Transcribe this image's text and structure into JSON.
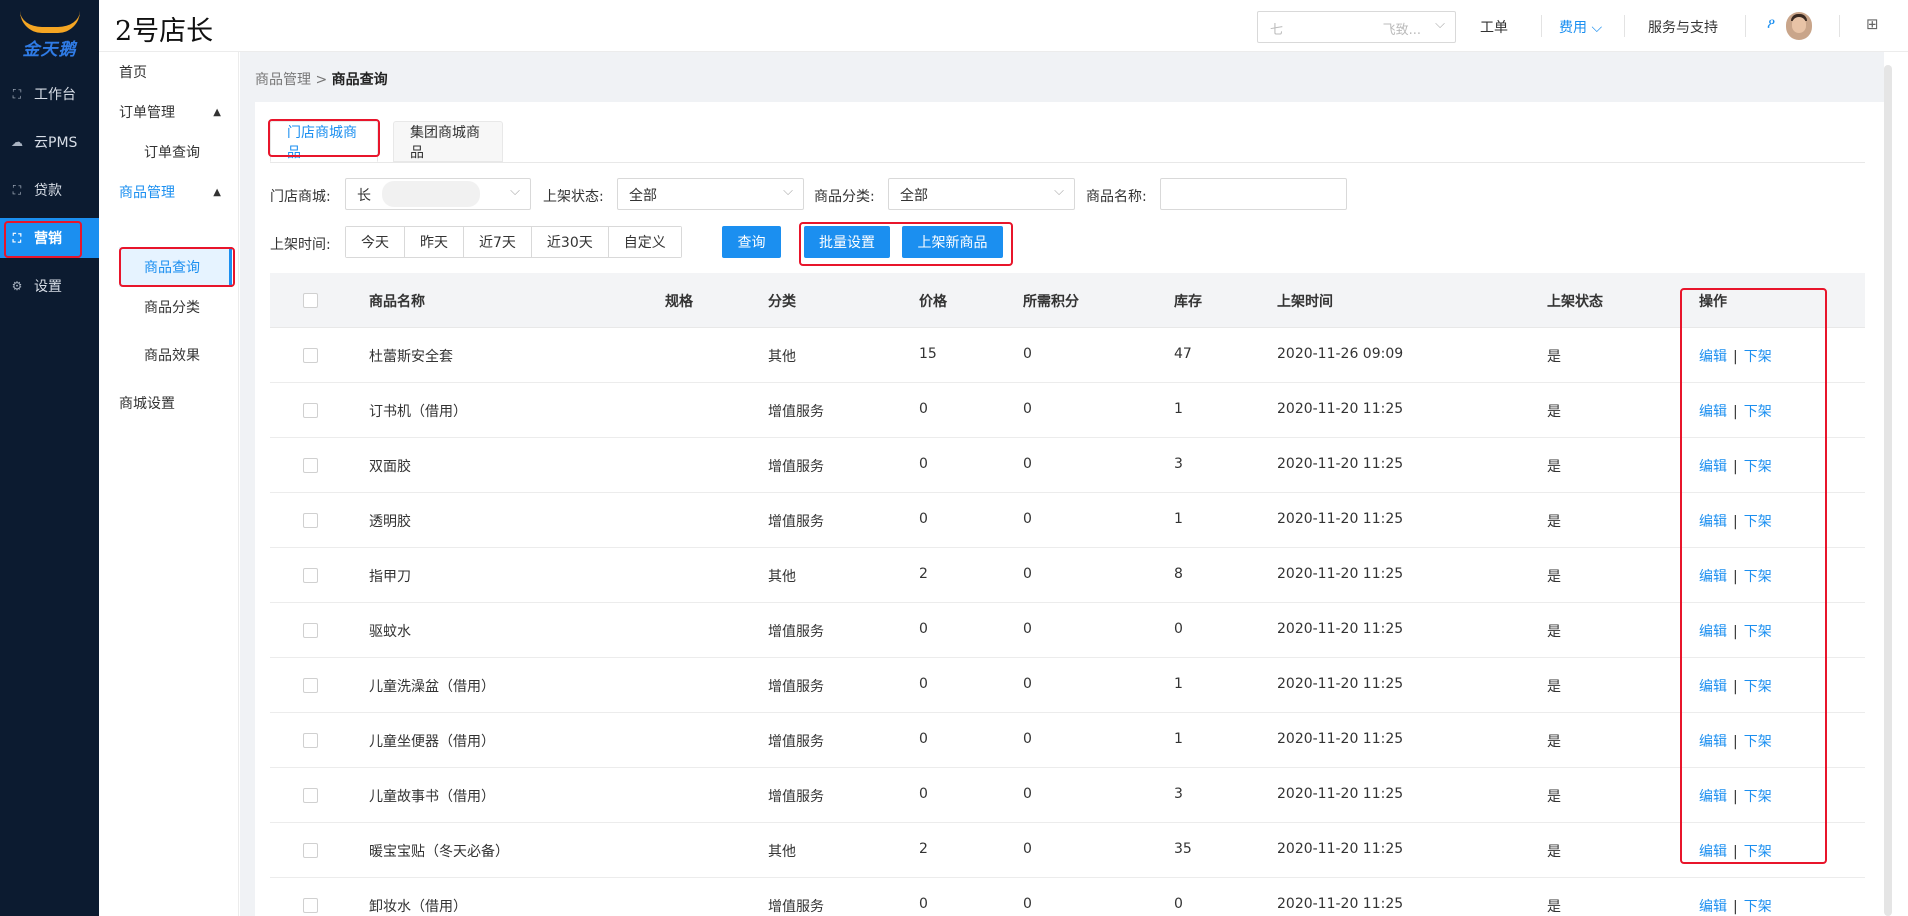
{
  "app": {
    "logo_text": "金天鹅",
    "brand_title": "2号店长",
    "colors": {
      "primary": "#1b8ff0",
      "sidebar_bg": "#0c1b30",
      "highlight": "#e8152b"
    }
  },
  "left_nav": [
    {
      "label": "工作台",
      "icon": "workbench-icon",
      "glyph": "⛶"
    },
    {
      "label": "云PMS",
      "icon": "cloud-icon",
      "glyph": "☁"
    },
    {
      "label": "贷款",
      "icon": "loan-icon",
      "glyph": "⛶"
    },
    {
      "label": "营销",
      "icon": "marketing-icon",
      "glyph": "⛶",
      "active": true
    },
    {
      "label": "设置",
      "icon": "settings-icon",
      "glyph": "⚙"
    }
  ],
  "topbar": {
    "select_left": "七",
    "select_right": "飞致...",
    "workorder": "工单",
    "fee": "费用",
    "support": "服务与支持"
  },
  "sub_nav": {
    "home": "首页",
    "order_mgmt": "订单管理",
    "order_query": "订单查询",
    "goods_mgmt": "商品管理",
    "goods_query": "商品查询",
    "goods_category": "商品分类",
    "goods_effect": "商品效果",
    "mall_settings": "商城设置"
  },
  "breadcrumb": {
    "parent": "商品管理 > ",
    "current": "商品查询"
  },
  "tabs": {
    "store": "门店商城商品",
    "group": "集团商城商品"
  },
  "filters": {
    "store_label": "门店商城:",
    "store_value": "长",
    "status_label": "上架状态:",
    "status_value": "全部",
    "category_label": "商品分类:",
    "category_value": "全部",
    "name_label": "商品名称:",
    "name_value": "",
    "time_label": "上架时间:",
    "time_options": [
      "今天",
      "昨天",
      "近7天",
      "近30天",
      "自定义"
    ],
    "query_button": "查询",
    "batch_button": "批量设置",
    "new_button": "上架新商品"
  },
  "table": {
    "columns": [
      "商品名称",
      "规格",
      "分类",
      "价格",
      "所需积分",
      "库存",
      "上架时间",
      "上架状态",
      "操作"
    ],
    "rows": [
      {
        "name": "杜蕾斯安全套",
        "spec": "",
        "category": "其他",
        "price": "15",
        "points": "0",
        "stock": "47",
        "time": "2020-11-26 09:09",
        "status": "是"
      },
      {
        "name": "订书机（借用）",
        "spec": "",
        "category": "增值服务",
        "price": "0",
        "points": "0",
        "stock": "1",
        "time": "2020-11-20 11:25",
        "status": "是"
      },
      {
        "name": "双面胶",
        "spec": "",
        "category": "增值服务",
        "price": "0",
        "points": "0",
        "stock": "3",
        "time": "2020-11-20 11:25",
        "status": "是"
      },
      {
        "name": "透明胶",
        "spec": "",
        "category": "增值服务",
        "price": "0",
        "points": "0",
        "stock": "1",
        "time": "2020-11-20 11:25",
        "status": "是"
      },
      {
        "name": "指甲刀",
        "spec": "",
        "category": "其他",
        "price": "2",
        "points": "0",
        "stock": "8",
        "time": "2020-11-20 11:25",
        "status": "是"
      },
      {
        "name": "驱蚊水",
        "spec": "",
        "category": "增值服务",
        "price": "0",
        "points": "0",
        "stock": "0",
        "time": "2020-11-20 11:25",
        "status": "是"
      },
      {
        "name": "儿童洗澡盆（借用）",
        "spec": "",
        "category": "增值服务",
        "price": "0",
        "points": "0",
        "stock": "1",
        "time": "2020-11-20 11:25",
        "status": "是"
      },
      {
        "name": "儿童坐便器（借用）",
        "spec": "",
        "category": "增值服务",
        "price": "0",
        "points": "0",
        "stock": "1",
        "time": "2020-11-20 11:25",
        "status": "是"
      },
      {
        "name": "儿童故事书（借用）",
        "spec": "",
        "category": "增值服务",
        "price": "0",
        "points": "0",
        "stock": "3",
        "time": "2020-11-20 11:25",
        "status": "是"
      },
      {
        "name": "暖宝宝贴（冬天必备）",
        "spec": "",
        "category": "其他",
        "price": "2",
        "points": "0",
        "stock": "35",
        "time": "2020-11-20 11:25",
        "status": "是"
      },
      {
        "name": "卸妆水（借用）",
        "spec": "",
        "category": "增值服务",
        "price": "0",
        "points": "0",
        "stock": "0",
        "time": "2020-11-20 11:25",
        "status": "是"
      }
    ],
    "edit_label": "编辑",
    "action_sep": "|",
    "offshelf_label": "下架"
  }
}
